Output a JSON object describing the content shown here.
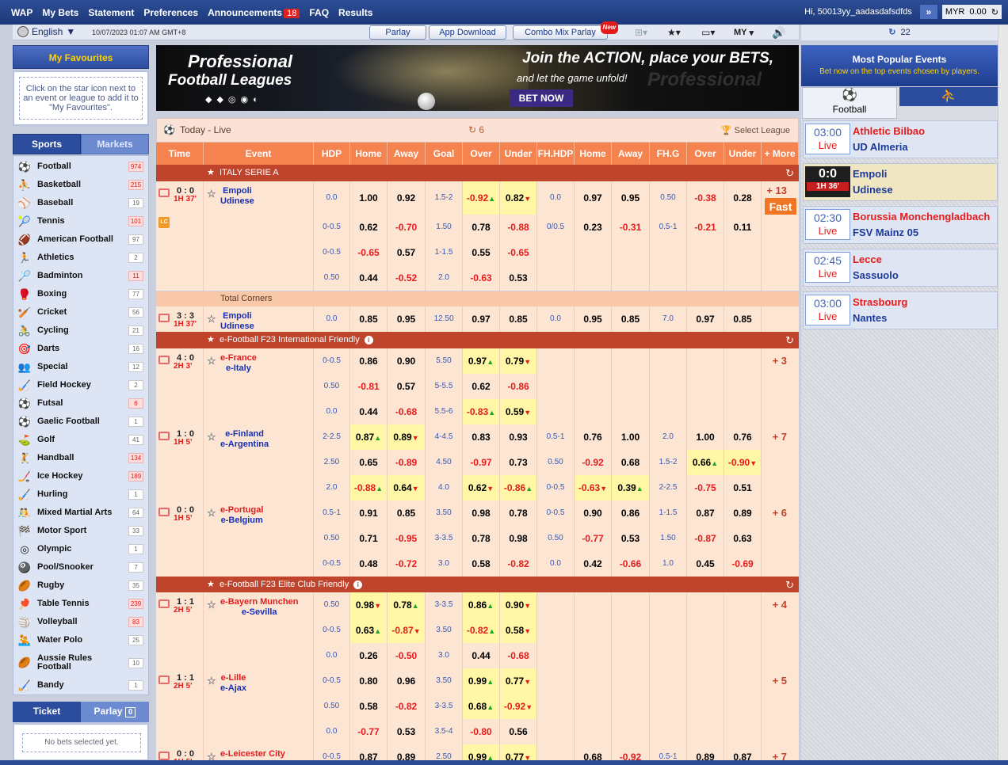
{
  "topnav": {
    "items": [
      "WAP",
      "My Bets",
      "Statement",
      "Preferences",
      "Announcements",
      "FAQ",
      "Results"
    ],
    "announcements_count": "18"
  },
  "user": {
    "greeting": "Hi, 50013yy_aadasdafsdfds",
    "currency": "MYR",
    "balance": "0.00"
  },
  "subbar": {
    "language": "English",
    "datetime": "10/07/2023 01:07 AM GMT+8",
    "parlay": "Parlay",
    "app_download": "App Download",
    "combo": "Combo Mix Parlay",
    "new_tag": "New",
    "odds_type": "MY",
    "right_count": "22"
  },
  "favourites": {
    "title": "My Favourites",
    "hint": "Click on the star icon next to an event or league to add it to \"My Favourites\"."
  },
  "side_tabs": {
    "sports": "Sports",
    "markets": "Markets"
  },
  "sports": [
    {
      "name": "Football",
      "count": "974",
      "hot": true,
      "icon": "football-icon"
    },
    {
      "name": "Basketball",
      "count": "215",
      "hot": true,
      "icon": "basketball-icon"
    },
    {
      "name": "Baseball",
      "count": "19",
      "hot": false,
      "icon": "baseball-icon"
    },
    {
      "name": "Tennis",
      "count": "101",
      "hot": true,
      "icon": "tennis-icon"
    },
    {
      "name": "American Football",
      "count": "97",
      "hot": false,
      "icon": "american-football-icon"
    },
    {
      "name": "Athletics",
      "count": "2",
      "hot": false,
      "icon": "athletics-icon"
    },
    {
      "name": "Badminton",
      "count": "11",
      "hot": true,
      "icon": "badminton-icon"
    },
    {
      "name": "Boxing",
      "count": "77",
      "hot": false,
      "icon": "boxing-icon"
    },
    {
      "name": "Cricket",
      "count": "56",
      "hot": false,
      "icon": "cricket-icon"
    },
    {
      "name": "Cycling",
      "count": "21",
      "hot": false,
      "icon": "cycling-icon"
    },
    {
      "name": "Darts",
      "count": "16",
      "hot": false,
      "icon": "darts-icon"
    },
    {
      "name": "Special",
      "count": "12",
      "hot": false,
      "icon": "special-icon"
    },
    {
      "name": "Field Hockey",
      "count": "2",
      "hot": false,
      "icon": "field-hockey-icon"
    },
    {
      "name": "Futsal",
      "count": "6",
      "hot": true,
      "icon": "futsal-icon"
    },
    {
      "name": "Gaelic Football",
      "count": "1",
      "hot": false,
      "icon": "gaelic-football-icon"
    },
    {
      "name": "Golf",
      "count": "41",
      "hot": false,
      "icon": "golf-icon"
    },
    {
      "name": "Handball",
      "count": "134",
      "hot": true,
      "icon": "handball-icon"
    },
    {
      "name": "Ice Hockey",
      "count": "189",
      "hot": true,
      "icon": "ice-hockey-icon"
    },
    {
      "name": "Hurling",
      "count": "1",
      "hot": false,
      "icon": "hurling-icon"
    },
    {
      "name": "Mixed Martial Arts",
      "count": "64",
      "hot": false,
      "icon": "mma-icon"
    },
    {
      "name": "Motor Sport",
      "count": "33",
      "hot": false,
      "icon": "motor-sport-icon"
    },
    {
      "name": "Olympic",
      "count": "1",
      "hot": false,
      "icon": "olympic-icon"
    },
    {
      "name": "Pool/Snooker",
      "count": "7",
      "hot": false,
      "icon": "pool-icon"
    },
    {
      "name": "Rugby",
      "count": "35",
      "hot": false,
      "icon": "rugby-icon"
    },
    {
      "name": "Table Tennis",
      "count": "239",
      "hot": true,
      "icon": "table-tennis-icon"
    },
    {
      "name": "Volleyball",
      "count": "83",
      "hot": true,
      "icon": "volleyball-icon"
    },
    {
      "name": "Water Polo",
      "count": "25",
      "hot": false,
      "icon": "water-polo-icon"
    },
    {
      "name": "Aussie Rules Football",
      "count": "10",
      "hot": false,
      "icon": "aussie-rules-icon"
    },
    {
      "name": "Bandy",
      "count": "1",
      "hot": false,
      "icon": "bandy-icon"
    }
  ],
  "ticket": {
    "ticket": "Ticket",
    "parlay": "Parlay",
    "parlay_count": "0",
    "empty": "No bets selected yet."
  },
  "banner": {
    "line1": "Professional",
    "line2": "Football Leagues",
    "line3": "Join the ACTION, place your BETS,",
    "line4": "and let the game unfold!",
    "cta": "BET NOW"
  },
  "odds_header": {
    "title": "Today - Live",
    "count": "6",
    "select_league": "Select League"
  },
  "columns": [
    "Time",
    "Event",
    "HDP",
    "Home",
    "Away",
    "Goal",
    "Over",
    "Under",
    "FH.HDP",
    "Home",
    "Away",
    "FH.G",
    "Over",
    "Under",
    "+ More"
  ],
  "leagues": [
    {
      "name": "ITALY SERIE A"
    },
    {
      "name": "e-Football F23 International Friendly"
    },
    {
      "name": "e-Football F23 Elite Club Friendly"
    }
  ],
  "subleague": "Total Corners",
  "matches": [
    {
      "score": "0 : 0",
      "time": "1H 37'",
      "home": "Empoli",
      "away": "Udinese",
      "more": "+ 13",
      "fast": "Fast"
    },
    {
      "score": "3 : 3",
      "time": "1H 37'",
      "home": "Empoli",
      "away": "Udinese"
    },
    {
      "score": "4 : 0",
      "time": "2H 3'",
      "home": "e-France",
      "away": "e-Italy",
      "more": "+ 3"
    },
    {
      "score": "1 : 0",
      "time": "1H 5'",
      "home": "e-Finland",
      "away": "e-Argentina",
      "more": "+ 7"
    },
    {
      "score": "0 : 0",
      "time": "1H 5'",
      "home": "e-Portugal",
      "away": "e-Belgium",
      "more": "+ 6"
    },
    {
      "score": "1 : 1",
      "time": "2H 5'",
      "home": "e-Bayern Munchen",
      "away": "e-Sevilla",
      "more": "+ 4"
    },
    {
      "score": "1 : 1",
      "time": "2H 5'",
      "home": "e-Lille",
      "away": "e-Ajax",
      "more": "+ 5"
    },
    {
      "score": "0 : 0",
      "time": "1H 5'",
      "home": "e-Leicester City",
      "more": "+ 7"
    }
  ],
  "rows": [
    [
      "0.0",
      "1.00",
      "0.92",
      "1.5-2",
      "-0.92▲",
      "0.82▼",
      "0.0",
      "0.97",
      "0.95",
      "0.50",
      "-0.38",
      "0.28"
    ],
    [
      "0-0.5",
      "0.62",
      "-0.70",
      "1.50",
      "0.78",
      "-0.88",
      "0/0.5",
      "0.23",
      "-0.31",
      "0.5-1",
      "-0.21",
      "0.11"
    ],
    [
      "0-0.5",
      "-0.65",
      "0.57",
      "1-1.5",
      "0.55",
      "-0.65",
      "",
      "",
      "",
      "",
      "",
      ""
    ],
    [
      "0.50",
      "0.44",
      "-0.52",
      "2.0",
      "-0.63",
      "0.53",
      "",
      "",
      "",
      "",
      "",
      ""
    ],
    [
      "0.0",
      "0.85",
      "0.95",
      "12.50",
      "0.97",
      "0.85",
      "0.0",
      "0.95",
      "0.85",
      "7.0",
      "0.97",
      "0.85"
    ],
    [
      "0-0.5",
      "0.86",
      "0.90",
      "5.50",
      "0.97▲",
      "0.79▼",
      "",
      "",
      "",
      "",
      "",
      ""
    ],
    [
      "0.50",
      "-0.81",
      "0.57",
      "5-5.5",
      "0.62",
      "-0.86",
      "",
      "",
      "",
      "",
      "",
      ""
    ],
    [
      "0.0",
      "0.44",
      "-0.68",
      "5.5-6",
      "-0.83▲",
      "0.59▼",
      "",
      "",
      "",
      "",
      "",
      ""
    ],
    [
      "2-2.5",
      "0.87▲",
      "0.89▼",
      "4-4.5",
      "0.83",
      "0.93",
      "0.5-1",
      "0.76",
      "1.00",
      "2.0",
      "1.00",
      "0.76"
    ],
    [
      "2.50",
      "0.65",
      "-0.89",
      "4.50",
      "-0.97",
      "0.73",
      "0.50",
      "-0.92",
      "0.68",
      "1.5-2",
      "0.66▲",
      "-0.90▼"
    ],
    [
      "2.0",
      "-0.88▲",
      "0.64▼",
      "4.0",
      "0.62▼",
      "-0.86▲",
      "0-0.5",
      "-0.63▼",
      "0.39▲",
      "2-2.5",
      "-0.75",
      "0.51"
    ],
    [
      "0.5-1",
      "0.91",
      "0.85",
      "3.50",
      "0.98",
      "0.78",
      "0-0.5",
      "0.90",
      "0.86",
      "1-1.5",
      "0.87",
      "0.89"
    ],
    [
      "0.50",
      "0.71",
      "-0.95",
      "3-3.5",
      "0.78",
      "0.98",
      "0.50",
      "-0.77",
      "0.53",
      "1.50",
      "-0.87",
      "0.63"
    ],
    [
      "0-0.5",
      "0.48",
      "-0.72",
      "3.0",
      "0.58",
      "-0.82",
      "0.0",
      "0.42",
      "-0.66",
      "1.0",
      "0.45",
      "-0.69"
    ],
    [
      "0.50",
      "0.98▼",
      "0.78▲",
      "3-3.5",
      "0.86▲",
      "0.90▼",
      "",
      "",
      "",
      "",
      "",
      ""
    ],
    [
      "0-0.5",
      "0.63▲",
      "-0.87▼",
      "3.50",
      "-0.82▲",
      "0.58▼",
      "",
      "",
      "",
      "",
      "",
      ""
    ],
    [
      "0.0",
      "0.26",
      "-0.50",
      "3.0",
      "0.44",
      "-0.68",
      "",
      "",
      "",
      "",
      "",
      ""
    ],
    [
      "0-0.5",
      "0.80",
      "0.96",
      "3.50",
      "0.99▲",
      "0.77▼",
      "",
      "",
      "",
      "",
      "",
      ""
    ],
    [
      "0.50",
      "0.58",
      "-0.82",
      "3-3.5",
      "0.68▲",
      "-0.92▼",
      "",
      "",
      "",
      "",
      "",
      ""
    ],
    [
      "0.0",
      "-0.77",
      "0.53",
      "3.5-4",
      "-0.80",
      "0.56",
      "",
      "",
      "",
      "",
      "",
      ""
    ],
    [
      "0-0.5",
      "0.87",
      "0.89",
      "2.50",
      "0.99▲",
      "0.77▼",
      "",
      "0.68",
      "-0.92",
      "0.5-1",
      "0.89",
      "0.87"
    ]
  ],
  "popular": {
    "title": "Most Popular Events",
    "subtitle": "Bet now on the top events chosen by players.",
    "tab": "Football",
    "events": [
      {
        "time": "03:00",
        "status": "Live",
        "home": "Athletic Bilbao",
        "away": "UD Almeria"
      },
      {
        "score": "0:0",
        "status": "1H 36'",
        "home": "Empoli",
        "away": "Udinese"
      },
      {
        "time": "02:30",
        "status": "Live",
        "home": "Borussia Monchengladbach",
        "away": "FSV Mainz 05"
      },
      {
        "time": "02:45",
        "status": "Live",
        "home": "Lecce",
        "away": "Sassuolo"
      },
      {
        "time": "03:00",
        "status": "Live",
        "home": "Strasbourg",
        "away": "Nantes"
      }
    ]
  }
}
